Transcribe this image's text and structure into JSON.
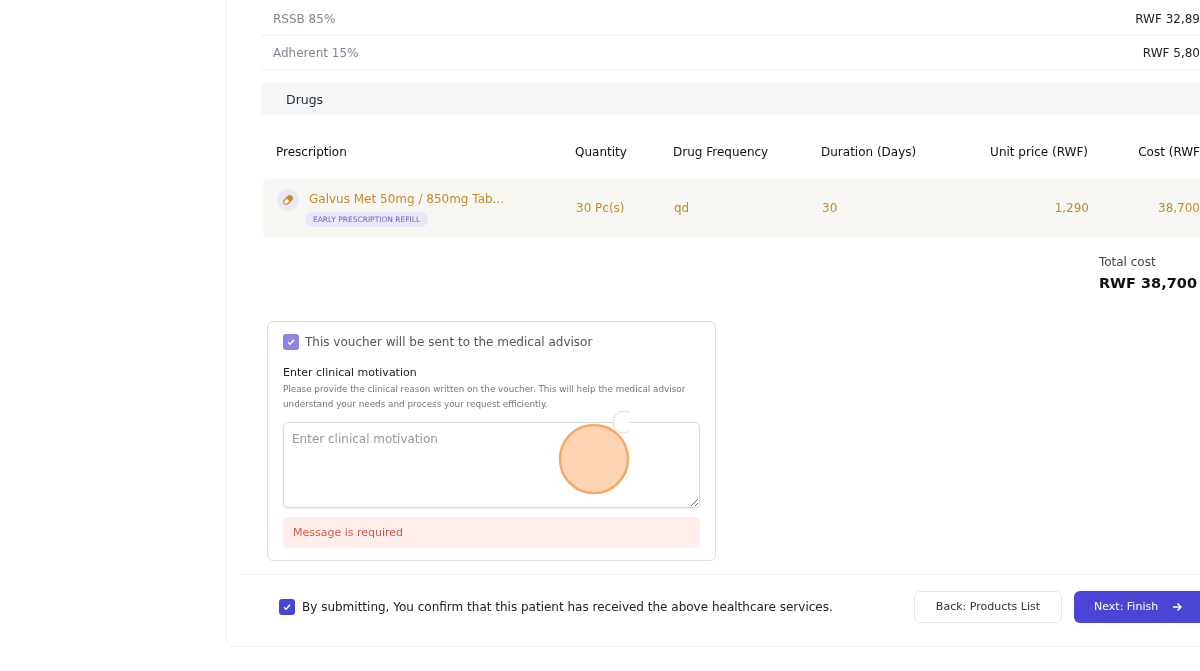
{
  "summary_rows": [
    {
      "label": "RSSB 85%",
      "value": "RWF 32,89"
    },
    {
      "label": "Adherent 15%",
      "value": "RWF 5,80"
    }
  ],
  "drugs_section": {
    "title": "Drugs"
  },
  "table": {
    "columns": [
      "Prescription",
      "Quantity",
      "Drug Frequency",
      "Duration (Days)",
      "Unit price (RWF)",
      "Cost (RWF"
    ],
    "rows": [
      {
        "prescription": "Galvus Met 50mg / 850mg Tab...",
        "tag": "EARLY PRESCRIPTION REFILL",
        "quantity": "30 Pc(s)",
        "frequency": "qd",
        "duration": "30",
        "unit_price": "1,290",
        "cost": "38,700"
      }
    ]
  },
  "total": {
    "label": "Total cost",
    "value": "RWF 38,700"
  },
  "voucher": {
    "checked": true,
    "label": "This voucher will be sent to the medical advisor",
    "heading": "Enter clinical motivation",
    "help": "Please provide the clinical reason written on the voucher. This will help the medical advisor understand your needs and process your request efficiently.",
    "placeholder": "Enter clinical motivation",
    "error": "Message is required"
  },
  "footer": {
    "confirm_checked": true,
    "confirm_text": "By submitting, You confirm that this patient has received the above healthcare services.",
    "back_button": "Back: Products List",
    "next_button": "Next: Finish"
  }
}
